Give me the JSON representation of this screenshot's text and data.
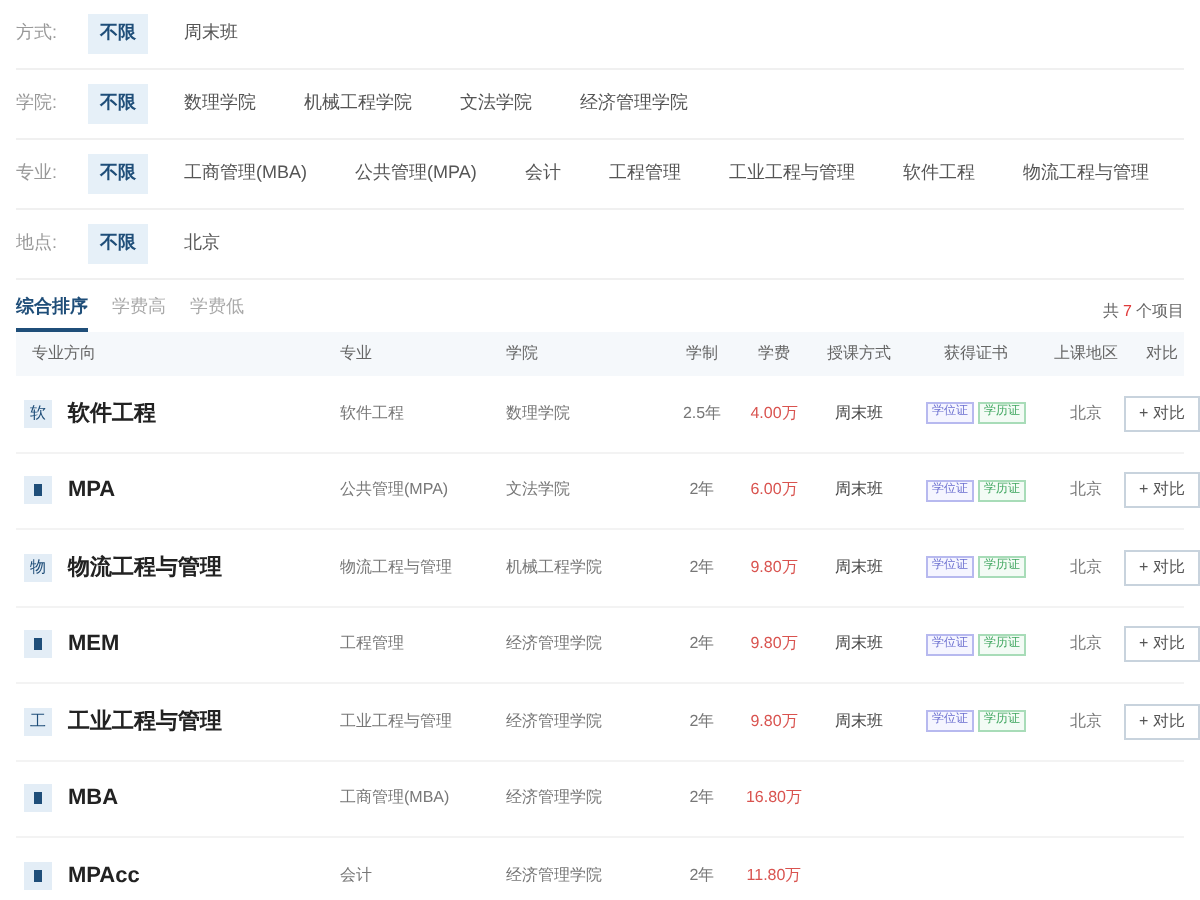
{
  "filters": [
    {
      "label": "方式:",
      "options": [
        {
          "text": "不限",
          "selected": true
        },
        {
          "text": "周末班",
          "selected": false
        }
      ]
    },
    {
      "label": "学院:",
      "options": [
        {
          "text": "不限",
          "selected": true
        },
        {
          "text": "数理学院",
          "selected": false
        },
        {
          "text": "机械工程学院",
          "selected": false
        },
        {
          "text": "文法学院",
          "selected": false
        },
        {
          "text": "经济管理学院",
          "selected": false
        }
      ]
    },
    {
      "label": "专业:",
      "options": [
        {
          "text": "不限",
          "selected": true
        },
        {
          "text": "工商管理(MBA)",
          "selected": false
        },
        {
          "text": "公共管理(MPA)",
          "selected": false
        },
        {
          "text": "会计",
          "selected": false
        },
        {
          "text": "工程管理",
          "selected": false
        },
        {
          "text": "工业工程与管理",
          "selected": false
        },
        {
          "text": "软件工程",
          "selected": false
        },
        {
          "text": "物流工程与管理",
          "selected": false
        }
      ]
    },
    {
      "label": "地点:",
      "options": [
        {
          "text": "不限",
          "selected": true
        },
        {
          "text": "北京",
          "selected": false
        }
      ]
    }
  ],
  "sort_tabs": [
    {
      "label": "综合排序",
      "selected": true
    },
    {
      "label": "学费高",
      "selected": false
    },
    {
      "label": "学费低",
      "selected": false
    }
  ],
  "total": {
    "prefix": "共",
    "count": "7",
    "suffix": "个项目"
  },
  "table": {
    "columns": [
      "专业方向",
      "专业",
      "学院",
      "学制",
      "学费",
      "授课方式",
      "获得证书",
      "上课地区",
      "对比"
    ],
    "rows": [
      {
        "badge": "软",
        "direction": "软件工程",
        "major": "软件工程",
        "college": "数理学院",
        "years": "2.5年",
        "fee": "4.00万",
        "method": "周末班",
        "certs": [
          "学位证",
          "学历证"
        ],
        "region": "北京",
        "compare": "+ 对比"
      },
      {
        "direction": "MPA",
        "major": "公共管理(MPA)",
        "college": "文法学院",
        "years": "2年",
        "fee": "6.00万",
        "method": "周末班",
        "certs": [
          "学位证",
          "学历证"
        ],
        "region": "北京",
        "compare": "+ 对比"
      },
      {
        "badge": "物",
        "direction": "物流工程与管理",
        "major": "物流工程与管理",
        "college": "机械工程学院",
        "years": "2年",
        "fee": "9.80万",
        "method": "周末班",
        "certs": [
          "学位证",
          "学历证"
        ],
        "region": "北京",
        "compare": "+ 对比"
      },
      {
        "direction": "MEM",
        "major": "工程管理",
        "college": "经济管理学院",
        "years": "2年",
        "fee": "9.80万",
        "method": "周末班",
        "certs": [
          "学位证",
          "学历证"
        ],
        "region": "北京",
        "compare": "+ 对比"
      },
      {
        "badge": "工",
        "direction": "工业工程与管理",
        "major": "工业工程与管理",
        "college": "经济管理学院",
        "years": "2年",
        "fee": "9.80万",
        "method": "周末班",
        "certs": [
          "学位证",
          "学历证"
        ],
        "region": "北京",
        "compare": "+ 对比"
      },
      {
        "direction": "MBA",
        "major": "工商管理(MBA)",
        "college": "经济管理学院",
        "years": "2年",
        "fee": "16.80万"
      },
      {
        "direction": "MPAcc",
        "major": "会计",
        "college": "经济管理学院",
        "years": "2年",
        "fee": "11.80万"
      }
    ]
  }
}
